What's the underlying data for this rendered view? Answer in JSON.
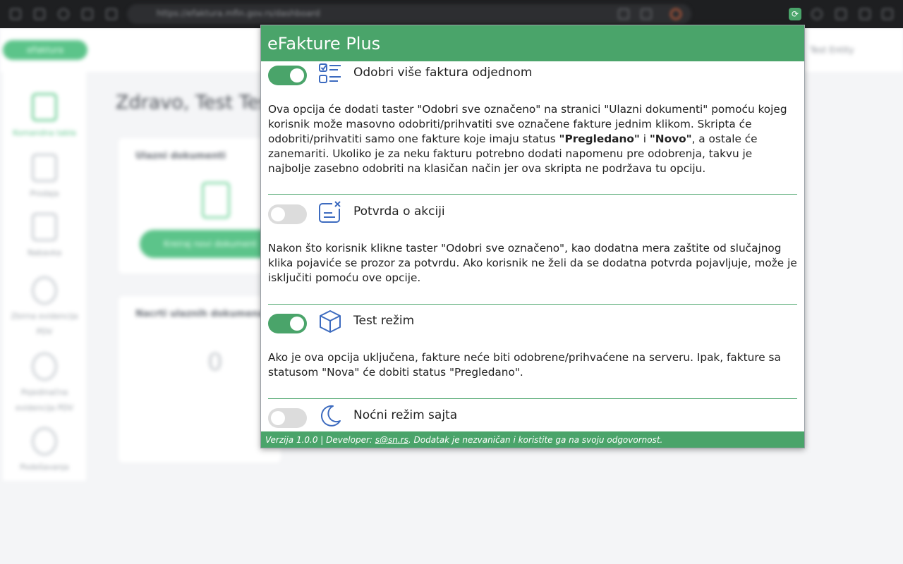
{
  "browser": {
    "url": "https://efaktura.mfin.gov.rs/dashboard",
    "extension_icon": "refresh-icon"
  },
  "background_page": {
    "logo_label": "eFaktura",
    "user_menu": "Test Entity",
    "greeting": "Zdravo, Test Test",
    "sidebar": [
      {
        "label": "Komandna tabla",
        "icon": "dashboard-icon"
      },
      {
        "label": "Prodaja",
        "icon": "file-plus-icon"
      },
      {
        "label": "Nabavka",
        "icon": "file-plus-icon"
      },
      {
        "label": "Zbirna evidencija PDV",
        "icon": "chat-icon"
      },
      {
        "label": "Pojedinačna evidencija PDV",
        "icon": "chat-icon"
      },
      {
        "label": "Podešavanja",
        "icon": "gear-icon"
      }
    ],
    "cards": {
      "incoming_title": "Ulazni dokumenti",
      "incoming_button": "Kreiraj novi dokument",
      "drafts_title": "Nacrti ulaznih dokumenata",
      "drafts_count": "0"
    }
  },
  "popup": {
    "title": "eFakture Plus",
    "options": [
      {
        "title": "Odobri više faktura odjednom",
        "enabled": true,
        "icon": "checklist-icon",
        "description_parts": [
          "Ova opcija će dodati taster \"Odobri sve označeno\" na stranici \"Ulazni dokumenti\" pomoću kojeg korisnik može masovno odobriti/prihvatiti sve označene fakture jednim klikom. Skripta će odobriti/prihvatiti samo one fakture koje imaju status ",
          "\"Pregledano\"",
          " i ",
          "\"Novo\"",
          ", a ostale će zanemariti. Ukoliko je za neku fakturu potrebno dodati napomenu pre odobrenja, takvu je najbolje zasebno odobriti na klasičan način jer ova skripta ne podržava tu opciju."
        ]
      },
      {
        "title": "Potvrda o akciji",
        "enabled": false,
        "icon": "confirm-dialog-icon",
        "description": "Nakon što korisnik klikne taster \"Odobri sve označeno\", kao dodatna mera zaštite od slučajnog klika pojaviće se prozor za potvrdu. Ako korisnik ne želi da se dodatna potvrda pojavljuje, može je isključiti pomoću ove opcije."
      },
      {
        "title": "Test režim",
        "enabled": true,
        "icon": "cube-icon",
        "description": "Ako je ova opcija uključena, fakture neće biti odobrene/prihvaćene na serveru. Ipak, fakture sa statusom \"Nova\" će dobiti status \"Pregledano\"."
      },
      {
        "title": "Noćni režim sajta",
        "enabled": false,
        "icon": "moon-icon"
      }
    ],
    "footer": {
      "prefix": "Verzija 1.0.0 | Developer: ",
      "email": "s@sn.rs",
      "suffix": ". Dodatak je nezvaničan i koristite ga na svoju odgovornost."
    },
    "accent_color": "#4aa46a"
  }
}
